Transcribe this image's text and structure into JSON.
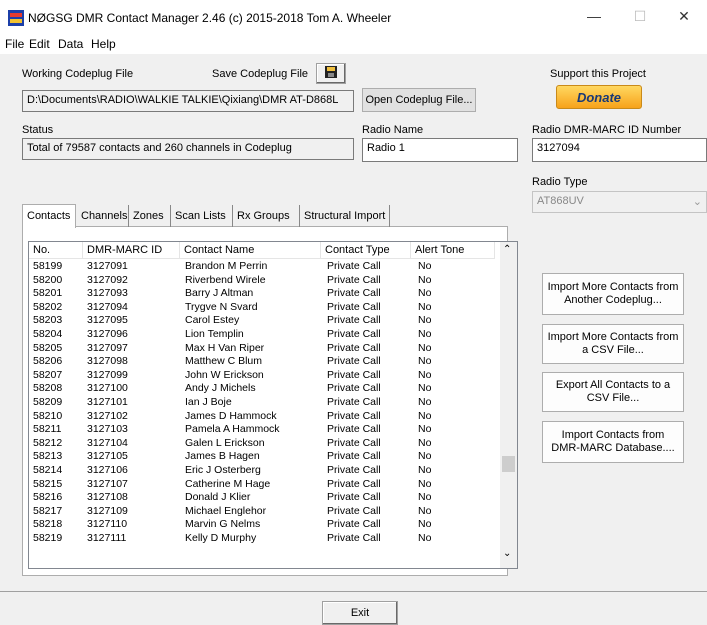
{
  "window": {
    "title": "NØGSG DMR Contact Manager 2.46 (c) 2015-2018 Tom A. Wheeler",
    "minimize": "—",
    "maximize": "☐",
    "close": "✕"
  },
  "menu": {
    "file": "File",
    "edit": "Edit",
    "data": "Data",
    "help": "Help"
  },
  "codeplug": {
    "label": "Working Codeplug File",
    "save_label": "Save Codeplug File",
    "path": "D:\\Documents\\RADIO\\WALKIE TALKIE\\Qixiang\\DMR AT-D868L",
    "open_button": "Open Codeplug File..."
  },
  "support": {
    "label": "Support this Project",
    "donate": "Donate"
  },
  "status": {
    "label": "Status",
    "text": "Total of 79587 contacts and 260 channels in Codeplug"
  },
  "radio": {
    "name_label": "Radio Name",
    "name_value": "Radio 1",
    "id_label": "Radio DMR-MARC ID Number",
    "id_value": "3127094",
    "type_label": "Radio Type",
    "type_value": "AT868UV"
  },
  "tabs": [
    "Contacts",
    "Channels",
    "Zones",
    "Scan Lists",
    "Rx Groups",
    "Structural Import"
  ],
  "table": {
    "columns": [
      "No.",
      "DMR-MARC ID",
      "Contact Name",
      "Contact Type",
      "Alert Tone"
    ],
    "rows": [
      [
        "58199",
        "3127091",
        "Brandon M Perrin",
        "Private Call",
        "No"
      ],
      [
        "58200",
        "3127092",
        "Riverbend Wirele",
        "Private Call",
        "No"
      ],
      [
        "58201",
        "3127093",
        "Barry J Altman",
        "Private Call",
        "No"
      ],
      [
        "58202",
        "3127094",
        "Trygve N Svard",
        "Private Call",
        "No"
      ],
      [
        "58203",
        "3127095",
        "Carol Estey",
        "Private Call",
        "No"
      ],
      [
        "58204",
        "3127096",
        "Lion Templin",
        "Private Call",
        "No"
      ],
      [
        "58205",
        "3127097",
        "Max H Van Riper",
        "Private Call",
        "No"
      ],
      [
        "58206",
        "3127098",
        "Matthew C Blum",
        "Private Call",
        "No"
      ],
      [
        "58207",
        "3127099",
        "John W Erickson",
        "Private Call",
        "No"
      ],
      [
        "58208",
        "3127100",
        "Andy J Michels",
        "Private Call",
        "No"
      ],
      [
        "58209",
        "3127101",
        "Ian J Boje",
        "Private Call",
        "No"
      ],
      [
        "58210",
        "3127102",
        "James D Hammock",
        "Private Call",
        "No"
      ],
      [
        "58211",
        "3127103",
        "Pamela A Hammock",
        "Private Call",
        "No"
      ],
      [
        "58212",
        "3127104",
        "Galen L Erickson",
        "Private Call",
        "No"
      ],
      [
        "58213",
        "3127105",
        "James B Hagen",
        "Private Call",
        "No"
      ],
      [
        "58214",
        "3127106",
        "Eric J Osterberg",
        "Private Call",
        "No"
      ],
      [
        "58215",
        "3127107",
        "Catherine M Hage",
        "Private Call",
        "No"
      ],
      [
        "58216",
        "3127108",
        "Donald J Klier",
        "Private Call",
        "No"
      ],
      [
        "58217",
        "3127109",
        "Michael Englehor",
        "Private Call",
        "No"
      ],
      [
        "58218",
        "3127110",
        "Marvin G Nelms",
        "Private Call",
        "No"
      ],
      [
        "58219",
        "3127111",
        "Kelly D Murphy",
        "Private Call",
        "No"
      ]
    ]
  },
  "actions": {
    "import_codeplug": "Import More Contacts from Another Codeplug...",
    "import_csv": "Import More Contacts from a CSV File...",
    "export_csv": "Export All Contacts to a CSV File...",
    "import_marc": "Import Contacts from DMR-MARC Database...."
  },
  "exit": "Exit",
  "icons": [
    "app-icon",
    "save-disk-icon",
    "scroll-up-arrow-icon",
    "scroll-down-arrow-icon",
    "dropdown-arrow-icon"
  ]
}
